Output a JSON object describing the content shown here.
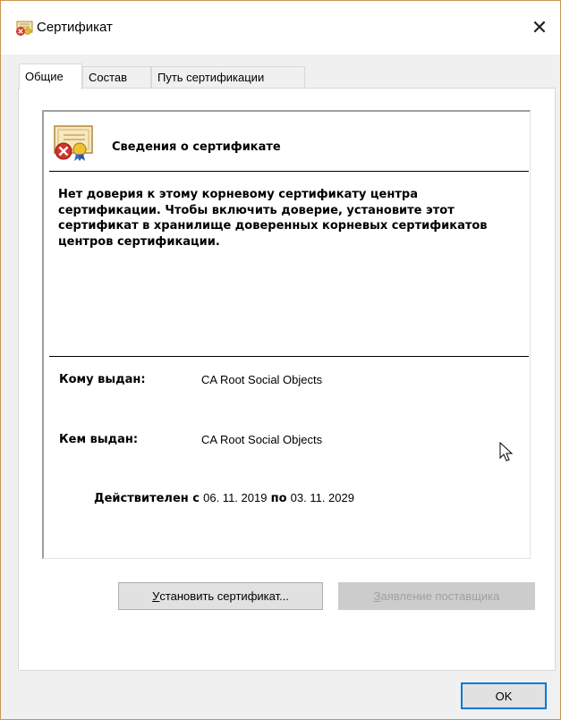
{
  "window": {
    "title": "Сертификат",
    "title_icon": "certificate-error-icon",
    "close_glyph": "✕"
  },
  "tabs": [
    {
      "label": "Общие",
      "active": true
    },
    {
      "label": "Состав",
      "active": false
    },
    {
      "label": "Путь сертификации",
      "active": false
    }
  ],
  "general": {
    "section_icon": "certificate-error-icon",
    "section_title": "Сведения о сертификате",
    "warning_text": "Нет доверия к этому корневому сертификату центра сертификации. Чтобы включить доверие, установите этот сертификат в хранилище доверенных корневых сертификатов центров сертификации.",
    "issued_to_label": "Кому выдан:",
    "issued_to_value": "CA Root Social Objects",
    "issued_by_label": "Кем выдан:",
    "issued_by_value": "CA Root Social Objects",
    "valid_from_label": "Действителен с",
    "valid_from_value": "06. 11. 2019",
    "valid_to_label": "по",
    "valid_to_value": "03. 11. 2029"
  },
  "buttons": {
    "install_prefix": "У",
    "install_rest": "становить сертификат...",
    "issuer_statement_prefix": "З",
    "issuer_statement_rest": "аявление поставщика",
    "ok": "OK"
  },
  "colors": {
    "accent": "#0078d7",
    "window_border": "#c9964f",
    "disabled_text": "#a0a0a0"
  }
}
